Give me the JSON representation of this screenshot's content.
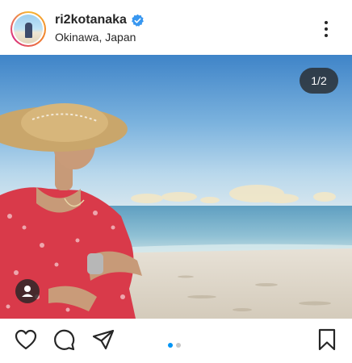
{
  "post": {
    "username": "ri2kotanaka",
    "location": "Okinawa, Japan",
    "image_counter": "1/2",
    "carousel_total": 2,
    "carousel_active_index": 1
  },
  "colors": {
    "verified_badge": "#3897f0",
    "active_dot": "#0095f6",
    "inactive_dot": "#c7c7c7",
    "icon": "#262626"
  },
  "icons": {
    "verified": "verified-badge-icon",
    "more": "more-options-icon",
    "tag": "user-tag-icon",
    "like": "heart-icon",
    "comment": "comment-icon",
    "share": "paper-plane-icon",
    "save": "bookmark-icon"
  }
}
